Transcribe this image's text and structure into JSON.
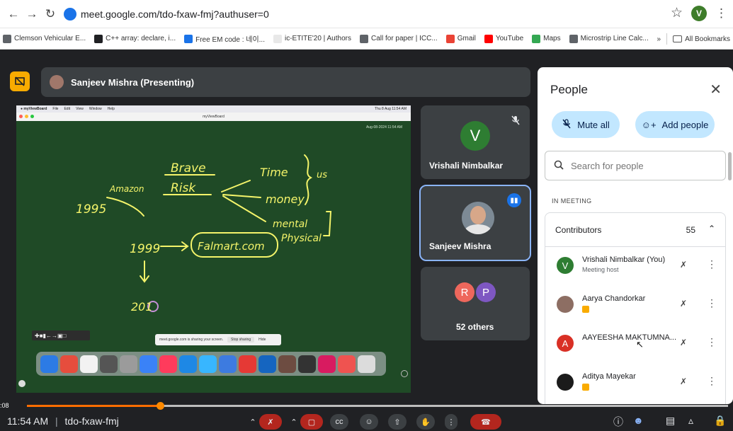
{
  "browser": {
    "url": "meet.google.com/tdo-fxaw-fmj?authuser=0",
    "profile_initial": "V",
    "bookmarks": [
      {
        "label": "Clemson Vehicular E...",
        "color": "#5f6368"
      },
      {
        "label": "C++ array: declare, i...",
        "color": "#202124"
      },
      {
        "label": "Free EM code : 네이...",
        "color": "#1a73e8"
      },
      {
        "label": "ic-ETITE'20 | Authors",
        "color": "#e8e8e8"
      },
      {
        "label": "Call for paper | ICC...",
        "color": "#5f6368"
      },
      {
        "label": "Gmail",
        "color": "#ea4335"
      },
      {
        "label": "YouTube",
        "color": "#ff0000"
      },
      {
        "label": "Maps",
        "color": "#34a853"
      },
      {
        "label": "Microstrip Line Calc...",
        "color": "#5f6368"
      }
    ],
    "overflow_label": "»",
    "all_bookmarks": "All Bookmarks"
  },
  "presenting": {
    "label": "Sanjeev Mishra (Presenting)"
  },
  "shared_screen": {
    "menu": [
      "myViewBoard",
      "File",
      "Edit",
      "View",
      "Window",
      "Help"
    ],
    "menu_clock": "Thu 8 Aug 11:54 AM",
    "window_title": "myViewBoard",
    "board_timestamp": "Aug-08-2024 11:54 AM",
    "handwriting": {
      "y1995": "1995",
      "amazon": "Amazon",
      "brave": "Brave",
      "risk": "Risk",
      "time": "Time",
      "money": "money",
      "mental": "mental",
      "physical": "Physical",
      "us": "us",
      "y1999": "1999",
      "falmart": "Falmart.com",
      "y201": "201"
    },
    "share_note": "meet.google.com is sharing your screen.",
    "stop_sharing": "Stop sharing",
    "hide": "Hide"
  },
  "tiles": [
    {
      "name": "Vrishali Nimbalkar",
      "initial": "V",
      "color": "#2e7d32"
    },
    {
      "name": "Sanjeev Mishra"
    },
    {
      "name": "52 others",
      "initials": [
        "R",
        "P"
      ],
      "colors": [
        "#ee675c",
        "#7e57c2"
      ]
    }
  ],
  "people_panel": {
    "title": "People",
    "mute_all": "Mute all",
    "add_people": "Add people",
    "search_placeholder": "Search for people",
    "in_meeting": "IN MEETING",
    "group_label": "Contributors",
    "group_count": "55",
    "members": [
      {
        "name": "Vrishali Nimbalkar (You)",
        "sub": "Meeting host",
        "initial": "V",
        "color": "#2e7d32"
      },
      {
        "name": "Aarya Chandorkar",
        "sub": "",
        "initial": "",
        "color": "#8d6e63"
      },
      {
        "name": "AAYEESHA MAKTUMNA...",
        "sub": "",
        "initial": "A",
        "color": "#d93025"
      },
      {
        "name": "Aditya Mayekar",
        "sub": "",
        "initial": "",
        "color": "#1b1b1b"
      }
    ]
  },
  "player": {
    "time_elapsed": ":08",
    "progress": 0.19
  },
  "controls": {
    "clock": "11:54 AM",
    "meeting_code": "tdo-fxaw-fmj",
    "separator": "|"
  }
}
